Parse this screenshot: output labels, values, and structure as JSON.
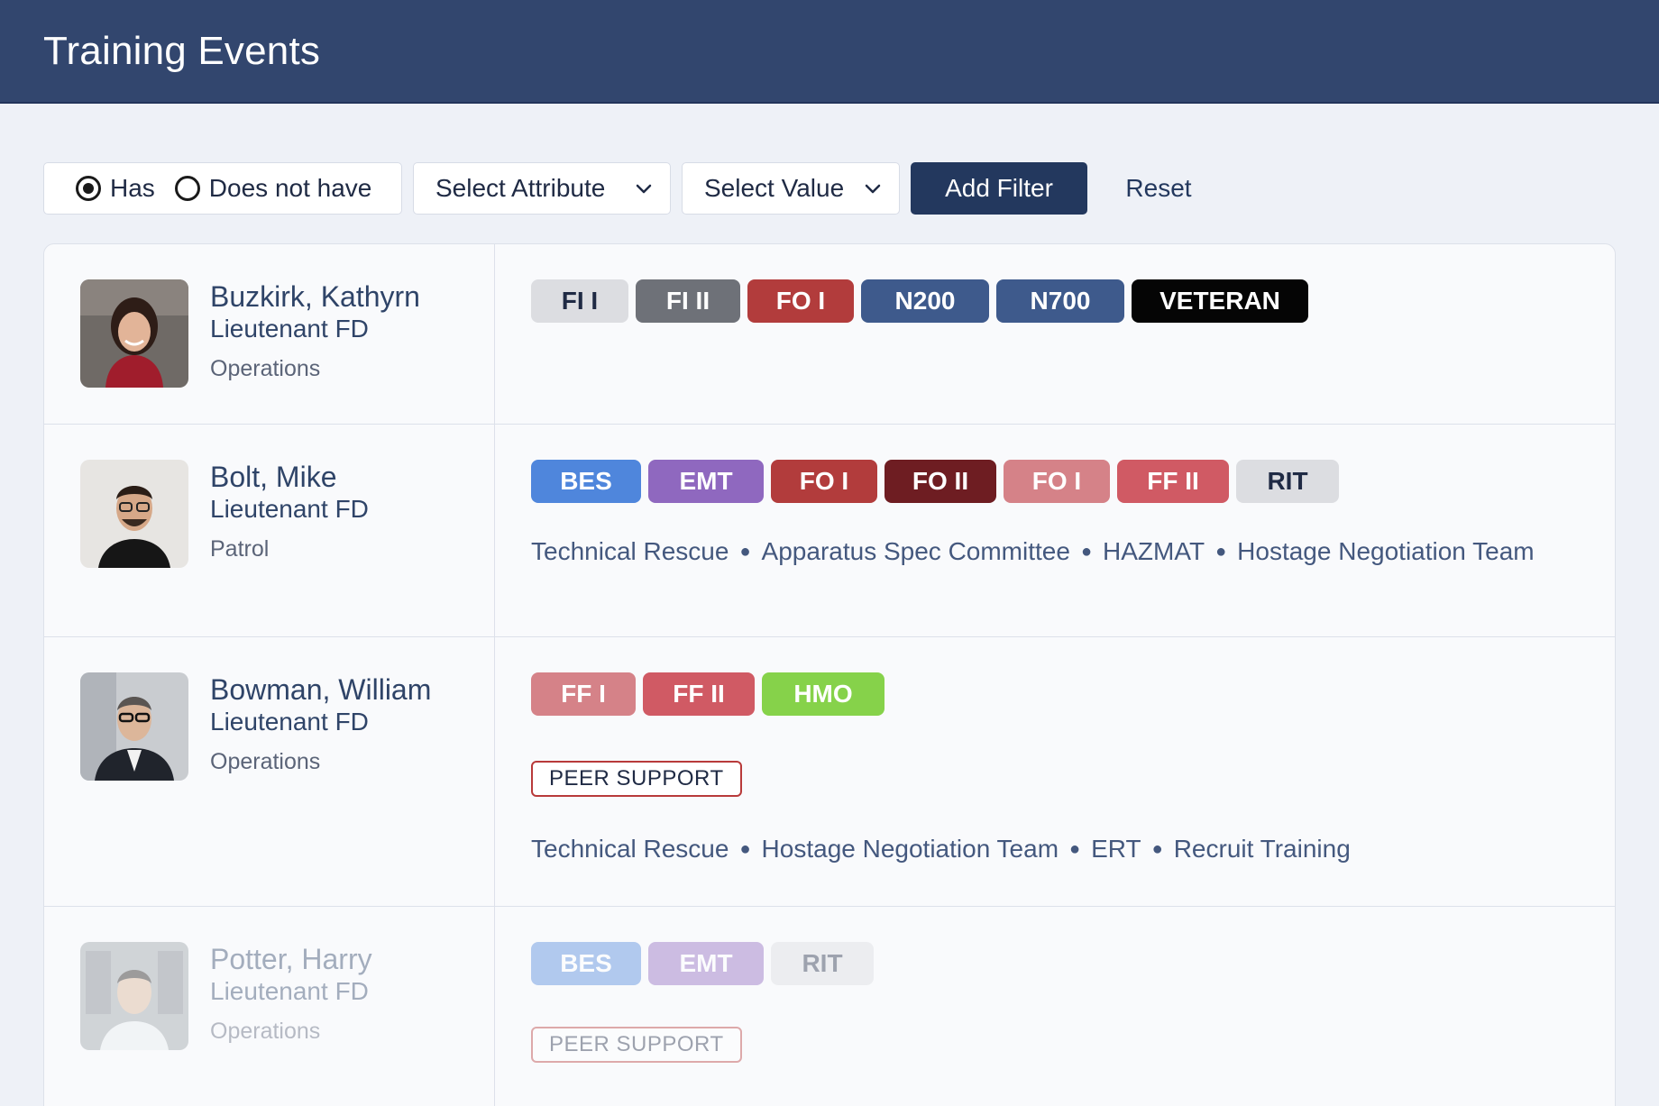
{
  "header": {
    "title": "Training Events"
  },
  "filters": {
    "radio": [
      {
        "label": "Has",
        "checked": true
      },
      {
        "label": "Does not have",
        "checked": false
      }
    ],
    "attribute_label": "Select Attribute",
    "value_label": "Select Value",
    "add_label": "Add Filter",
    "reset_label": "Reset"
  },
  "colors": {
    "header_bg": "#32466e",
    "primary_button": "#23385e",
    "peer_support_border": "#b83a3a"
  },
  "people": [
    {
      "name": "Buzkirk, Kathyrn",
      "rank": "Lieutenant FD",
      "dept": "Operations",
      "badges": [
        {
          "label": "FI I",
          "bg": "#dcdde1",
          "fg": "#1f2a44"
        },
        {
          "label": "FI II",
          "bg": "#6e7178",
          "fg": "#ffffff"
        },
        {
          "label": "FO I",
          "bg": "#b23c3c",
          "fg": "#ffffff"
        },
        {
          "label": "N200",
          "bg": "#3e5a8c",
          "fg": "#ffffff"
        },
        {
          "label": "N700",
          "bg": "#3e5a8c",
          "fg": "#ffffff"
        },
        {
          "label": "VETERAN",
          "bg": "#050505",
          "fg": "#ffffff"
        }
      ],
      "special": "",
      "tags": []
    },
    {
      "name": "Bolt, Mike",
      "rank": "Lieutenant FD",
      "dept": "Patrol",
      "badges": [
        {
          "label": "BES",
          "bg": "#4f86dc",
          "fg": "#ffffff"
        },
        {
          "label": "EMT",
          "bg": "#8f68bf",
          "fg": "#ffffff"
        },
        {
          "label": "FO I",
          "bg": "#b23c3c",
          "fg": "#ffffff"
        },
        {
          "label": "FO II",
          "bg": "#6e1d22",
          "fg": "#ffffff"
        },
        {
          "label": "FO I",
          "bg": "#d58288",
          "fg": "#ffffff"
        },
        {
          "label": "FF II",
          "bg": "#d05a64",
          "fg": "#ffffff"
        },
        {
          "label": "RIT",
          "bg": "#dcdde1",
          "fg": "#1f2a44"
        }
      ],
      "special": "",
      "tags": [
        "Technical Rescue",
        "Apparatus Spec Committee",
        "HAZMAT",
        "Hostage Negotiation Team"
      ]
    },
    {
      "name": "Bowman, William",
      "rank": "Lieutenant FD",
      "dept": "Operations",
      "badges": [
        {
          "label": "FF I",
          "bg": "#d58288",
          "fg": "#ffffff"
        },
        {
          "label": "FF II",
          "bg": "#d05a64",
          "fg": "#ffffff"
        },
        {
          "label": "HMO",
          "bg": "#86d24a",
          "fg": "#ffffff"
        }
      ],
      "special": "PEER SUPPORT",
      "tags": [
        "Technical Rescue",
        "Hostage Negotiation Team",
        "ERT",
        "Recruit Training"
      ]
    },
    {
      "name": "Potter, Harry",
      "rank": "Lieutenant FD",
      "dept": "Operations",
      "badges": [
        {
          "label": "BES",
          "bg": "#4f86dc",
          "fg": "#ffffff"
        },
        {
          "label": "EMT",
          "bg": "#8f68bf",
          "fg": "#ffffff"
        },
        {
          "label": "RIT",
          "bg": "#dcdde1",
          "fg": "#1f2a44"
        }
      ],
      "special": "PEER SUPPORT",
      "tags": []
    }
  ]
}
